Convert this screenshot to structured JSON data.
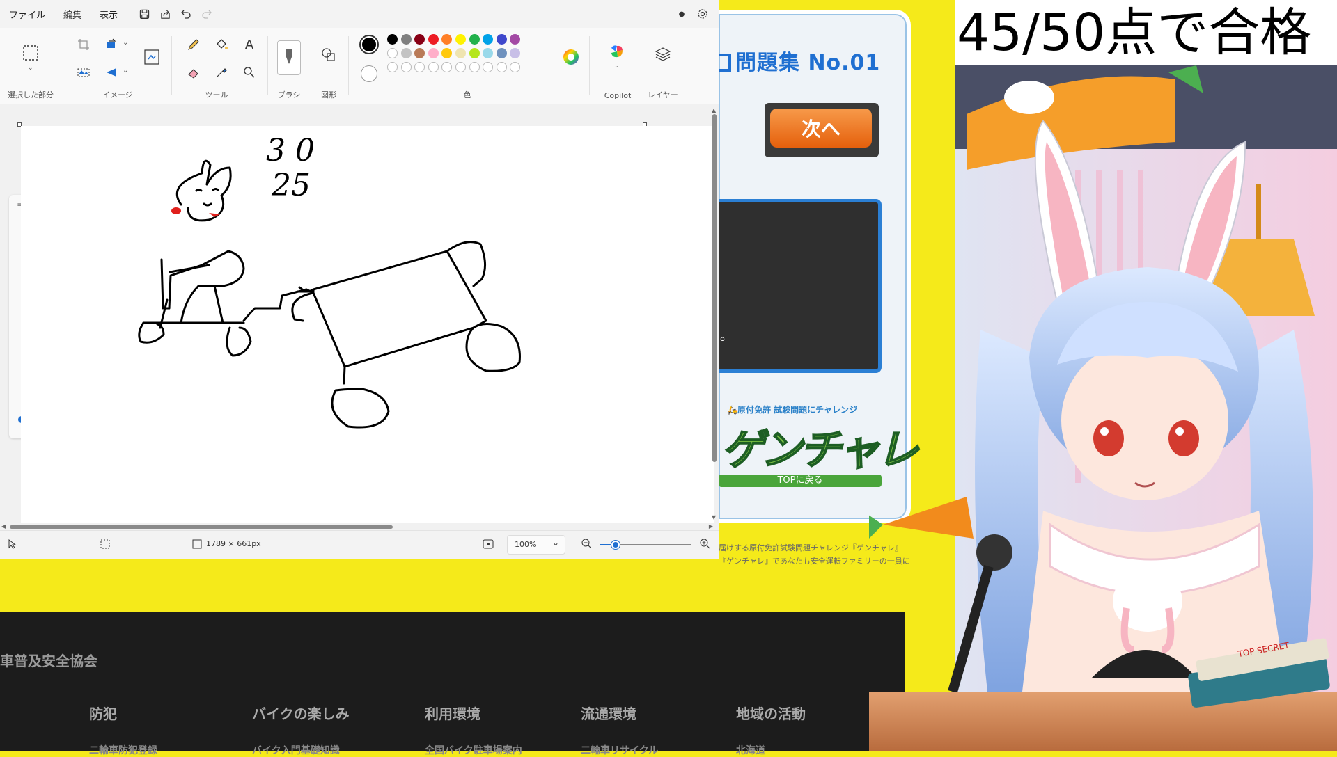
{
  "paint": {
    "menu": {
      "file": "ファイル",
      "edit": "編集",
      "view": "表示"
    },
    "quick_access": [
      "save-icon",
      "share-icon",
      "undo-icon",
      "redo-icon"
    ],
    "ribbon": {
      "selection_label": "選択した部分",
      "image_label": "イメージ",
      "tools_label": "ツール",
      "brush_label": "ブラシ",
      "shapes_label": "図形",
      "colors_label": "色",
      "copilot_label": "Copilot",
      "layers_label": "レイヤー"
    },
    "colors_row1": [
      "#000000",
      "#7f7f7f",
      "#880015",
      "#ed1c24",
      "#ff7f27",
      "#fff200",
      "#22b14c",
      "#00a2e8",
      "#3f48cc",
      "#a349a4"
    ],
    "colors_row2": [
      "#ffffff",
      "#c3c3c3",
      "#b97a57",
      "#ffaec9",
      "#ffc90e",
      "#efe4b0",
      "#b5e61d",
      "#99d9ea",
      "#7092be",
      "#c8bfe7"
    ],
    "primary_color": "#000000",
    "secondary_color": "#ffffff",
    "status": {
      "canvas_size": "1789 × 661px",
      "zoom": "100%"
    },
    "drawing_text": [
      "3 0",
      "25"
    ]
  },
  "site": {
    "panel_title": "問題集 No.01",
    "next_button": "次へ",
    "question_tail": "。",
    "logo_subtitle": "原付免許 試験問題にチャレンジ",
    "logo_text": "ゲンチャレ",
    "top_button": "TOPに戻る",
    "footer_lines": [
      "届けする原付免許試験問題チャレンジ『ゲンチャレ』",
      "『ゲンチャレ』であなたも安全運転ファミリーの一員に"
    ],
    "footer": {
      "org": "車普及安全協会",
      "nav": [
        "防犯",
        "バイクの楽しみ",
        "利用環境",
        "流通環境",
        "地域の活動"
      ],
      "sub": [
        "二輪車防犯登録",
        "バイク入門基礎知識",
        "全国バイク駐車場案内",
        "二輪車リサイクル",
        "北海道"
      ]
    }
  },
  "overlay": {
    "score_text": "45/50点で合格"
  },
  "avatar": {
    "sign_text": "TOP SECRET"
  }
}
